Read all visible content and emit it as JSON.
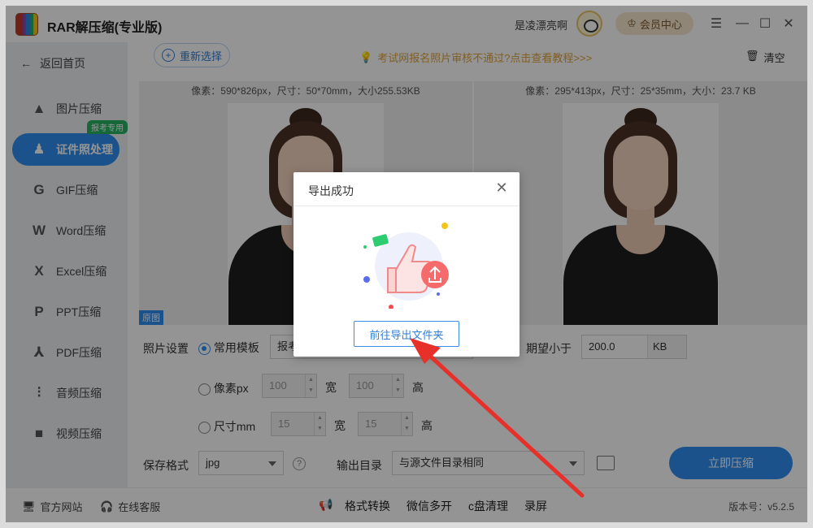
{
  "titlebar": {
    "app_title": "RAR解压缩(专业版)",
    "user_name": "是凌漂亮啊",
    "vip_label": "会员中心",
    "controls": [
      "☰",
      "—",
      "☐",
      "✕"
    ]
  },
  "sidebar": {
    "back_label": "返回首页",
    "badge": "报考专用",
    "items": [
      {
        "label": "图片压缩",
        "icon": "image-compress-icon"
      },
      {
        "label": "证件照处理",
        "icon": "id-photo-icon"
      },
      {
        "label": "GIF压缩",
        "icon": "gif-icon"
      },
      {
        "label": "Word压缩",
        "icon": "word-icon"
      },
      {
        "label": "Excel压缩",
        "icon": "excel-icon"
      },
      {
        "label": "PPT压缩",
        "icon": "ppt-icon"
      },
      {
        "label": "PDF压缩",
        "icon": "pdf-icon"
      },
      {
        "label": "音频压缩",
        "icon": "audio-icon"
      },
      {
        "label": "视频压缩",
        "icon": "video-icon"
      }
    ]
  },
  "toolbar": {
    "reselect_label": "重新选择",
    "tip_label": "考试网报名照片审核不通过?点击查看教程>>>",
    "clear_label": "清空"
  },
  "preview": {
    "left_info": "像素：590*826px，尺寸：50*70mm，大小255.53KB",
    "right_info": "像素：295*413px，尺寸：25*35mm，大小：23.7 KB",
    "orig_tag": "原图"
  },
  "settings": {
    "photo_settings_label": "照片设置",
    "template_label": "常用模板",
    "template_value": "报考",
    "expect_label": "期望小于",
    "expect_value": "200.0",
    "expect_unit": "KB",
    "pixel_label": "像素px",
    "pixel_w": "100",
    "pixel_h": "100",
    "size_label": "尺寸mm",
    "size_w": "15",
    "size_h": "15",
    "width_label": "宽",
    "height_label": "高",
    "save_format_label": "保存格式",
    "save_format_value": "jpg",
    "output_dir_label": "输出目录",
    "output_dir_value": "与源文件目录相同",
    "compress_label": "立即压缩"
  },
  "footer": {
    "official_site": "官方网站",
    "online_service": "在线客服",
    "tools": [
      "格式转换",
      "微信多开",
      "c盘清理",
      "录屏"
    ],
    "version": "版本号：v5.2.5"
  },
  "modal": {
    "title": "导出成功",
    "button_label": "前往导出文件夹"
  },
  "colors": {
    "accent": "#2f8ef0",
    "tip": "#e0a33a",
    "annotation_arrow": "#e8302a"
  }
}
